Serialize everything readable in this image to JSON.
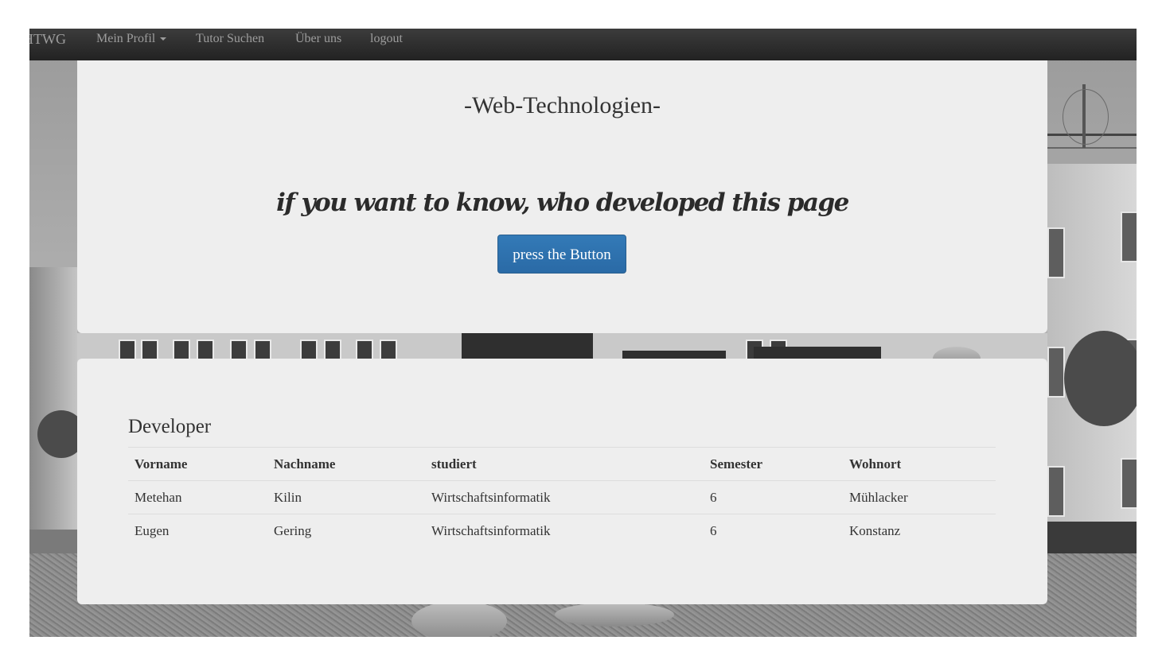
{
  "navbar": {
    "brand": "HTWG",
    "items": [
      {
        "label": "Mein Profil",
        "has_caret": true
      },
      {
        "label": "Tutor Suchen"
      },
      {
        "label": "Über uns"
      },
      {
        "label": "logout"
      }
    ]
  },
  "hero": {
    "title": "-Web-Technologien-",
    "tagline": "if you want to know, who developed this page",
    "button_label": "press the Button"
  },
  "developers": {
    "title": "Developer",
    "columns": [
      "Vorname",
      "Nachname",
      "studiert",
      "Semester",
      "Wohnort"
    ],
    "rows": [
      [
        "Metehan",
        "Kilin",
        "Wirtschaftsinformatik",
        "6",
        "Mühlacker"
      ],
      [
        "Eugen",
        "Gering",
        "Wirtschaftsinformatik",
        "6",
        "Konstanz"
      ]
    ]
  },
  "colors": {
    "navbar": "#222222",
    "panel": "#eeeeee",
    "primary_button": "#337ab7"
  }
}
